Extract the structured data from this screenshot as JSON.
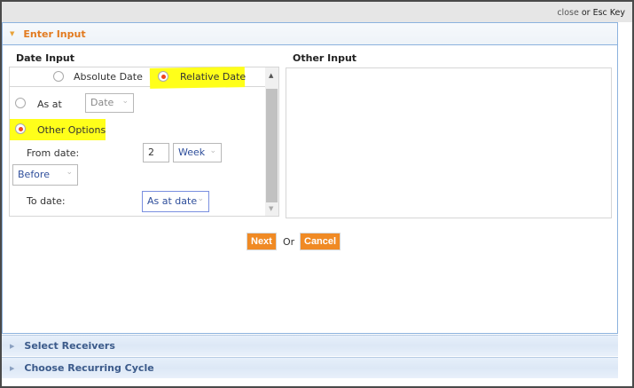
{
  "dialog": {
    "close_link": "close",
    "close_hint": " or Esc Key"
  },
  "enter_input": {
    "title": "Enter Input",
    "date_input_label": "Date Input",
    "other_input_label": "Other Input",
    "mode_options": [
      {
        "label": "Absolute Date",
        "selected": false
      },
      {
        "label": "Relative Date",
        "selected": true
      }
    ],
    "as_at": {
      "label": "As at",
      "selected": false,
      "select_value": "Date"
    },
    "other_options": {
      "label": "Other Options",
      "selected": true
    },
    "from_date": {
      "label": "From date:",
      "number": "2",
      "unit": "Week",
      "direction": "Before"
    },
    "to_date": {
      "label": "To date:",
      "value": "As at date"
    },
    "next_label": "Next",
    "or_label": "Or",
    "cancel_label": "Cancel"
  },
  "sections": [
    {
      "title": "Select Receivers"
    },
    {
      "title": "Choose Recurring Cycle"
    }
  ],
  "colors": {
    "accent": "#f08a24",
    "highlight": "#ffff1a",
    "header_text": "#e27a1f"
  }
}
